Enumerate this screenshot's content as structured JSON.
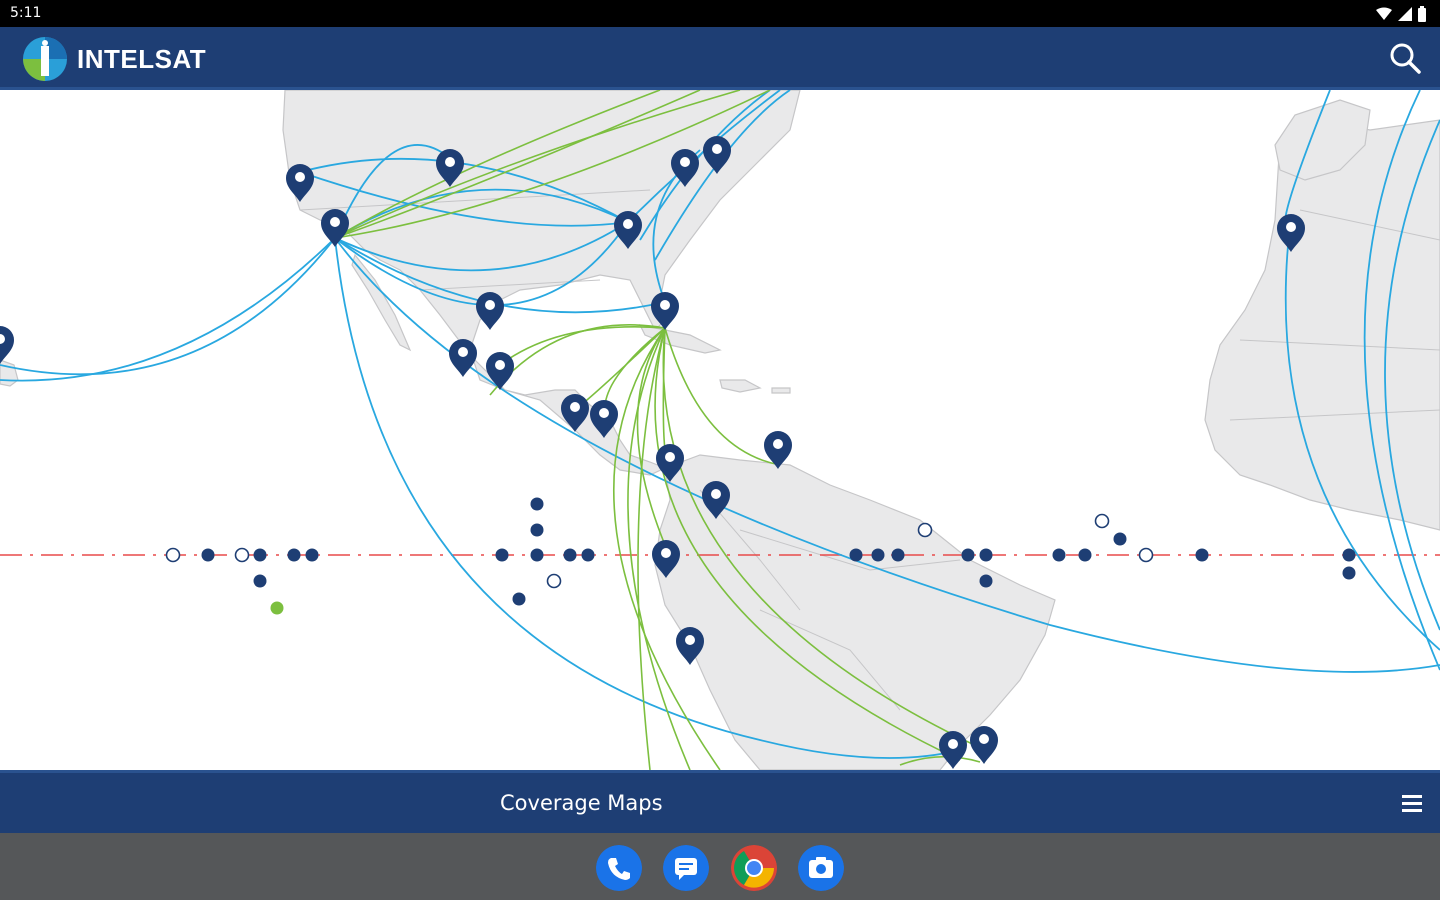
{
  "status_bar": {
    "time": "5:11",
    "icons": [
      "wifi-icon",
      "signal-icon",
      "battery-icon"
    ]
  },
  "header": {
    "brand": "INTELSAT",
    "logo_icon": "intelsat-logo-icon",
    "search_icon": "search-icon"
  },
  "map": {
    "description_icons": [
      "location-pin-icon",
      "satellite-dot-icon"
    ],
    "colors": {
      "land": "#e9e9ea",
      "border": "#c6c6c8",
      "pin": "#1e3e74",
      "link_blue": "#29a8e0",
      "link_green": "#7cbf3f",
      "equator": "#e84a4a",
      "dot_filled": "#1e3e74",
      "dot_green": "#7cbf3f"
    }
  },
  "bottom_bar": {
    "title": "Coverage Maps",
    "menu_icon": "hamburger-menu-icon"
  },
  "dock": {
    "apps": [
      "phone-icon",
      "messages-icon",
      "chrome-icon",
      "camera-icon"
    ]
  },
  "colors": {
    "primary": "#1e3e74",
    "nav": "#555759"
  }
}
